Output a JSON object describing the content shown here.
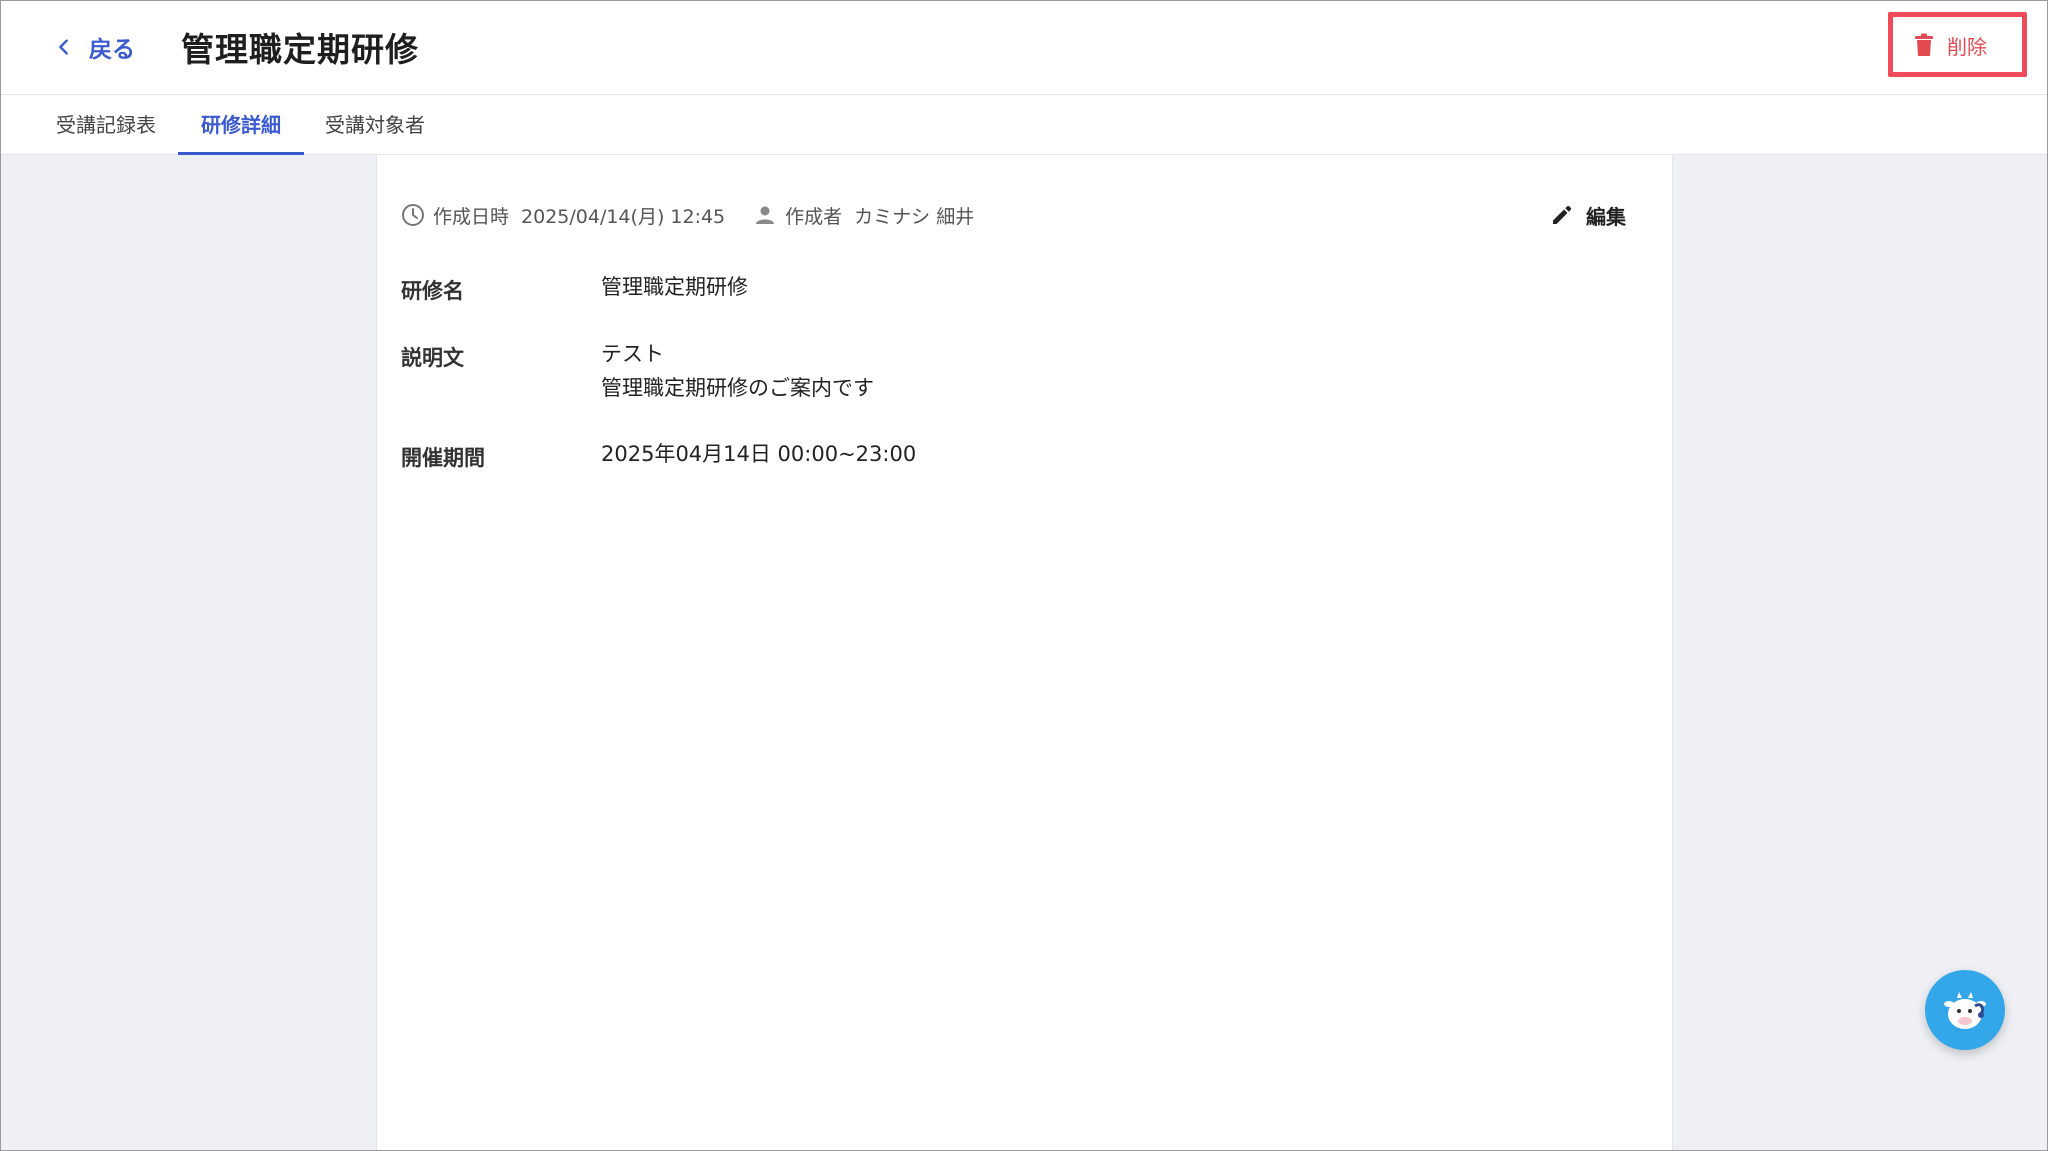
{
  "header": {
    "back_label": "戻る",
    "title": "管理職定期研修",
    "delete_label": "削除"
  },
  "tabs": [
    {
      "label": "受講記録表",
      "active": false
    },
    {
      "label": "研修詳細",
      "active": true
    },
    {
      "label": "受講対象者",
      "active": false
    }
  ],
  "meta": {
    "created_at_label": "作成日時",
    "created_at_value": "2025/04/14(月) 12:45",
    "creator_label": "作成者",
    "creator_value": "カミナシ 細井"
  },
  "edit_label": "編集",
  "details": {
    "name_label": "研修名",
    "name_value": "管理職定期研修",
    "description_label": "説明文",
    "description_lines": [
      "テスト",
      "管理職定期研修のご案内です"
    ],
    "period_label": "開催期間",
    "period_value": "2025年04月14日 00:00~23:00"
  },
  "colors": {
    "accent": "#3a5bd0",
    "danger": "#e24b52",
    "highlight_border": "#ef4b5a",
    "background": "#eef0f5",
    "chatbot": "#34a6ea"
  },
  "icons": {
    "back": "chevron-left-icon",
    "delete": "trash-icon",
    "created_at": "clock-icon",
    "creator": "person-icon",
    "edit": "pencil-icon",
    "chatbot": "cow-mascot-icon"
  }
}
